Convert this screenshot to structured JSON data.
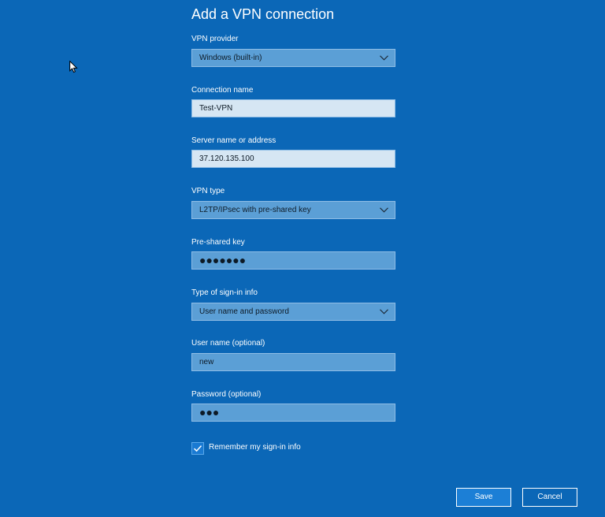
{
  "colors": {
    "background": "#0b67b7",
    "field_light": "#d6e6f3",
    "field_mid": "#5b9fd6",
    "button_accent": "#1c7fd6"
  },
  "dialog": {
    "title": "Add a VPN connection"
  },
  "fields": {
    "vpn_provider": {
      "label": "VPN provider",
      "value": "Windows (built-in)"
    },
    "connection_name": {
      "label": "Connection name",
      "value": "Test-VPN"
    },
    "server": {
      "label": "Server name or address",
      "value": "37.120.135.100"
    },
    "vpn_type": {
      "label": "VPN type",
      "value": "L2TP/IPsec with pre-shared key"
    },
    "pre_shared_key": {
      "label": "Pre-shared key",
      "masked_value": "●●●●●●●"
    },
    "sign_in_type": {
      "label": "Type of sign-in info",
      "value": "User name and password"
    },
    "username": {
      "label": "User name (optional)",
      "value": "new"
    },
    "password": {
      "label": "Password (optional)",
      "masked_value": "●●●"
    }
  },
  "remember": {
    "label": "Remember my sign-in info",
    "checked": true
  },
  "buttons": {
    "save": "Save",
    "cancel": "Cancel"
  },
  "icons": {
    "dropdown": "chevron-down-icon",
    "checkbox": "checkmark-icon",
    "cursor": "mouse-pointer-icon"
  }
}
